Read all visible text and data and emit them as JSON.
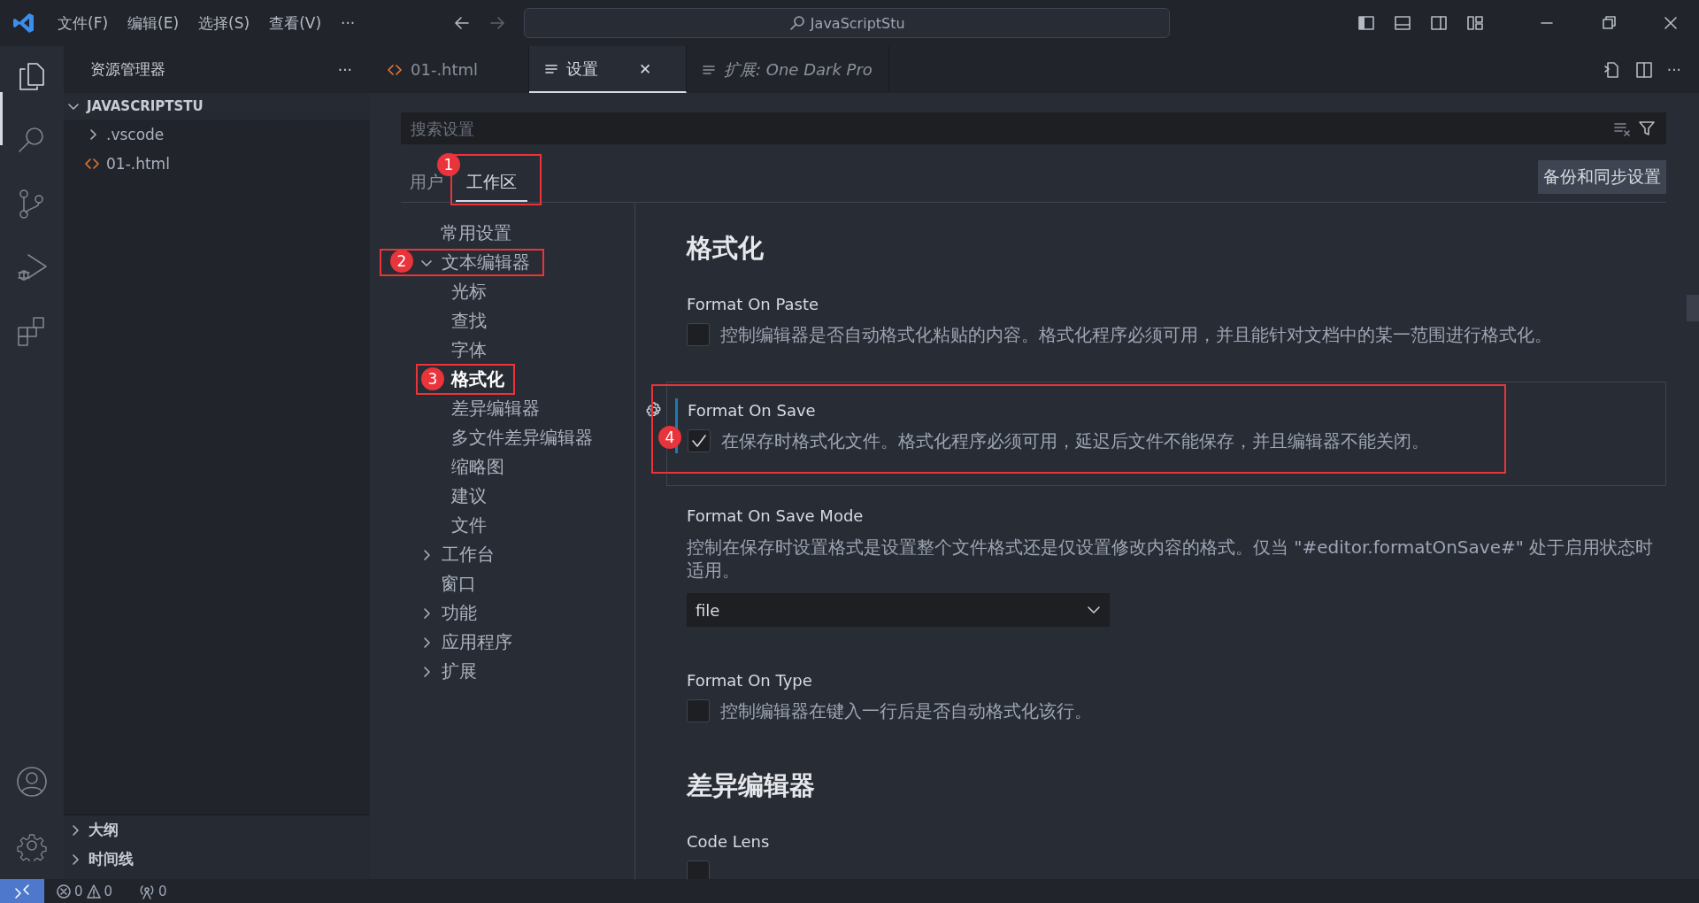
{
  "title_bar": {
    "menus": [
      "文件(F)",
      "编辑(E)",
      "选择(S)",
      "查看(V)"
    ],
    "more": "···",
    "command_center": "JavaScriptStu"
  },
  "sidebar": {
    "title": "资源管理器",
    "more": "···",
    "folder": {
      "name": "JAVASCRIPTSTU",
      "expanded": true,
      "children": [
        {
          "name": ".vscode",
          "kind": "folder",
          "expanded": false
        },
        {
          "name": "01-.html",
          "kind": "html"
        }
      ]
    },
    "sections": [
      {
        "name": "大纲",
        "expanded": false
      },
      {
        "name": "时间线",
        "expanded": false
      }
    ]
  },
  "editor_tabs": [
    {
      "label": "01-.html",
      "kind": "html",
      "selected": false
    },
    {
      "label": "设置",
      "kind": "settings",
      "selected": true,
      "close": "✕"
    },
    {
      "label": "扩展: One Dark Pro",
      "kind": "preview",
      "selected": false
    }
  ],
  "settings": {
    "search": {
      "placeholder": "搜索设置"
    },
    "scopes": [
      {
        "label": "用户",
        "selected": false
      },
      {
        "label": "工作区",
        "selected": true,
        "marker": "1"
      }
    ],
    "sync_button": "备份和同步设置",
    "toc": [
      {
        "label": "常用设置",
        "selected": false
      },
      {
        "label": "文本编辑器",
        "selected": false,
        "expanded": true,
        "marker": "2",
        "children": [
          {
            "label": "光标",
            "selected": false
          },
          {
            "label": "查找",
            "selected": false
          },
          {
            "label": "字体",
            "selected": false
          },
          {
            "label": "格式化",
            "selected": true,
            "marker": "3"
          },
          {
            "label": "差异编辑器",
            "selected": false
          },
          {
            "label": "多文件差异编辑器",
            "selected": false
          },
          {
            "label": "缩略图",
            "selected": false
          },
          {
            "label": "建议",
            "selected": false
          },
          {
            "label": "文件",
            "selected": false
          }
        ]
      },
      {
        "label": "工作台",
        "selected": false,
        "expanded": false
      },
      {
        "label": "窗口",
        "selected": false
      },
      {
        "label": "功能",
        "selected": false,
        "expanded": false
      },
      {
        "label": "应用程序",
        "selected": false,
        "expanded": false
      },
      {
        "label": "扩展",
        "selected": false,
        "expanded": false
      }
    ],
    "items": [
      {
        "kind": "heading",
        "text": "格式化"
      },
      {
        "kind": "checkbox",
        "title": "Format On Paste",
        "description": "控制编辑器是否自动格式化粘贴的内容。格式化程序必须可用，并且能针对文档中的某一范围进行格式化。",
        "checked": false,
        "focused": false
      },
      {
        "kind": "checkbox",
        "title": "Format On Save",
        "description": "在保存时格式化文件。格式化程序必须可用，延迟后文件不能保存，并且编辑器不能关闭。",
        "checked": true,
        "focused": true,
        "marker": "4"
      },
      {
        "kind": "dropdown",
        "title": "Format On Save Mode",
        "description": "控制在保存时设置格式是设置整个文件格式还是仅设置修改内容的格式。仅当 \"#editor.formatOnSave#\" 处于启用状态时适用。",
        "value": "file"
      },
      {
        "kind": "checkbox",
        "title": "Format On Type",
        "description": "控制编辑器在键入一行后是否自动格式化该行。",
        "checked": false,
        "focused": false
      },
      {
        "kind": "heading",
        "text": "差异编辑器"
      },
      {
        "kind": "checkbox",
        "title": "Code Lens",
        "checked": false,
        "focused": false
      }
    ]
  },
  "status_bar": {
    "errors": "0",
    "warnings": "0",
    "ports": "0"
  }
}
